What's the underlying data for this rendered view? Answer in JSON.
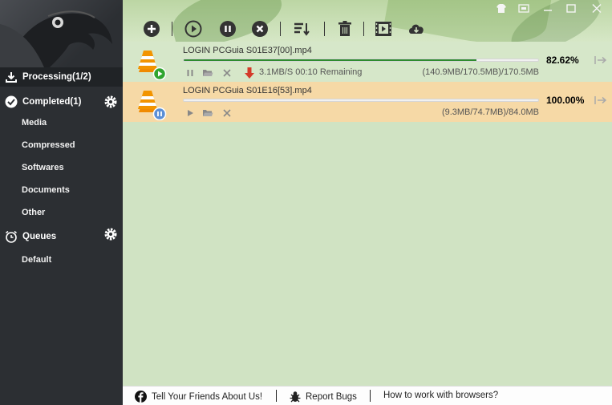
{
  "sidebar": {
    "processing_label": "Processing(1/2)",
    "completed_label": "Completed(1)",
    "categories": [
      "Media",
      "Compressed",
      "Softwares",
      "Documents",
      "Other"
    ],
    "queues_label": "Queues",
    "queue_items": [
      "Default"
    ]
  },
  "toolbar": {
    "buttons": [
      "add-icon",
      "play-icon",
      "pause-icon",
      "stop-icon",
      "sort-icon",
      "delete-icon",
      "video-icon",
      "cloud-download-icon"
    ]
  },
  "downloads": [
    {
      "filename": "LOGIN PCGuia S01E37[00].mp4",
      "percent": "82.62%",
      "progress": 0.8262,
      "speed": "3.1MB/S 00:10 Remaining",
      "sizes": "(140.9MB/170.5MB)/170.5MB",
      "status": "downloading"
    },
    {
      "filename": "LOGIN PCGuia S01E16[53].mp4",
      "percent": "100.00%",
      "progress": 1.0,
      "speed": "",
      "sizes": "(9.3MB/74.7MB)/84.0MB",
      "status": "paused"
    }
  ],
  "footer": {
    "tell_friends": "Tell Your Friends About Us!",
    "report_bugs": "Report Bugs",
    "how_to": "How to work with browsers?"
  },
  "colors": {
    "sidebar_bg": "#2c2f33",
    "main_bg": "#d0e3c3",
    "selected_row": "#f6d9a6",
    "progress_fill": "#2e8b2e"
  }
}
